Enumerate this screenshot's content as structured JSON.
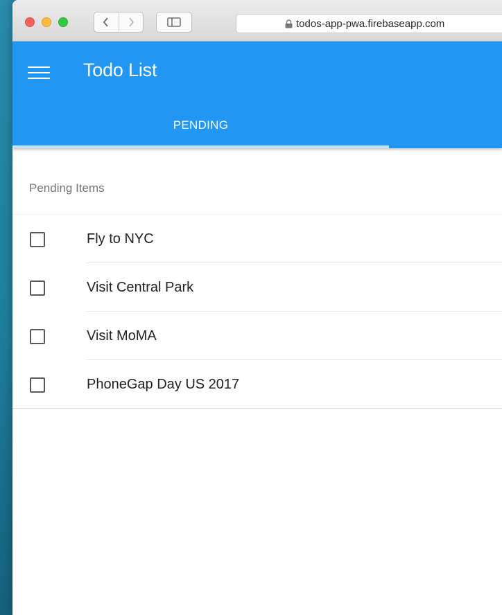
{
  "browser": {
    "url": "todos-app-pwa.firebaseapp.com"
  },
  "app": {
    "title": "Todo List",
    "accent_color": "#2196f3",
    "tabs": [
      {
        "label": "PENDING",
        "selected": true
      }
    ]
  },
  "pending": {
    "subheader": "Pending Items",
    "items": [
      {
        "label": "Fly to NYC",
        "checked": false
      },
      {
        "label": "Visit Central Park",
        "checked": false
      },
      {
        "label": "Visit MoMA",
        "checked": false
      },
      {
        "label": "PhoneGap Day US 2017",
        "checked": false
      }
    ]
  }
}
